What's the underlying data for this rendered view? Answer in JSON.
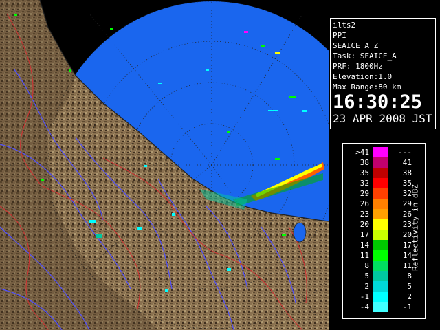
{
  "info": {
    "site": "ilts2",
    "scan_type": "PPI",
    "product": "SEAICE_A_Z",
    "task": "Task: SEAICE_A",
    "prf": "PRF: 1800Hz",
    "elevation": "Elevation:1.0",
    "max_range": "Max Range:80 km",
    "time": "16:30:25",
    "date": "23 APR 2008 JST"
  },
  "legend": {
    "title": "Reflectivity in dBZ",
    "rows": [
      {
        "lo": ">41",
        "hi": "---",
        "color": "#ff00ff"
      },
      {
        "lo": "38",
        "hi": "41",
        "color": "#c0006e"
      },
      {
        "lo": "35",
        "hi": "38",
        "color": "#c00000"
      },
      {
        "lo": "32",
        "hi": "35",
        "color": "#ff0000"
      },
      {
        "lo": "29",
        "hi": "32",
        "color": "#ff4000"
      },
      {
        "lo": "26",
        "hi": "29",
        "color": "#ff8000"
      },
      {
        "lo": "23",
        "hi": "26",
        "color": "#ffa000"
      },
      {
        "lo": "20",
        "hi": "23",
        "color": "#ffff00"
      },
      {
        "lo": "17",
        "hi": "20",
        "color": "#c8ff00"
      },
      {
        "lo": "14",
        "hi": "17",
        "color": "#00c800"
      },
      {
        "lo": "11",
        "hi": "14",
        "color": "#00ff00"
      },
      {
        "lo": "8",
        "hi": "11",
        "color": "#00e060"
      },
      {
        "lo": "5",
        "hi": "8",
        "color": "#00c8a0"
      },
      {
        "lo": "2",
        "hi": "5",
        "color": "#00d8d8"
      },
      {
        "lo": "-1",
        "hi": "2",
        "color": "#00ffff"
      },
      {
        "lo": "-4",
        "hi": "-1",
        "color": "#40ffff"
      }
    ]
  },
  "colors": {
    "sea": "#1a66ee",
    "sea_outer": "#0000ff",
    "land": "#8a7150",
    "river": "#5050ff",
    "boundary": "#cc3333"
  }
}
